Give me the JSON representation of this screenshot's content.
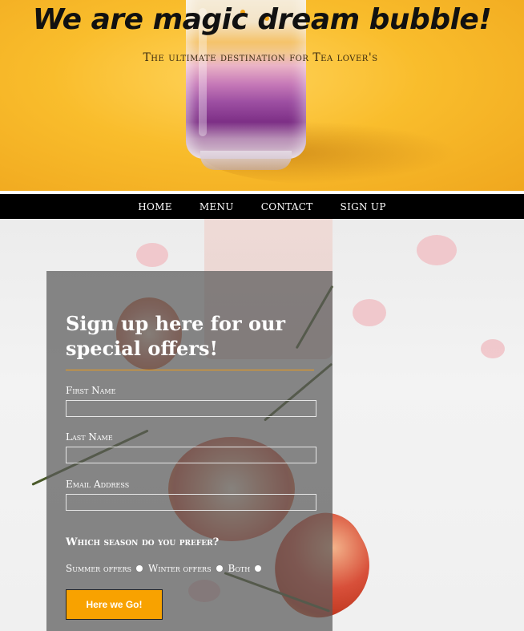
{
  "hero": {
    "title": "We are magic dream bubble!",
    "subtitle": "The ultimate destination for Tea lover's"
  },
  "nav": {
    "items": [
      {
        "label": "HOME"
      },
      {
        "label": "MENU"
      },
      {
        "label": "CONTACT"
      },
      {
        "label": "SIGN UP"
      }
    ]
  },
  "form": {
    "heading": "Sign up here for our special offers!",
    "first_name_label": "First Name",
    "first_name_value": "",
    "last_name_label": "Last Name",
    "last_name_value": "",
    "email_label": "Email Address",
    "email_value": "",
    "season_question": "Which season do you prefer?",
    "season_options": [
      {
        "label": "Summer offers"
      },
      {
        "label": "Winter offers"
      },
      {
        "label": "Both"
      }
    ],
    "submit_label": "Here we Go!"
  },
  "colors": {
    "hero_bg": "#f9bd2c",
    "nav_bg": "#000000",
    "accent": "#f8a200",
    "panel_bg": "rgba(90,90,90,0.72)"
  }
}
